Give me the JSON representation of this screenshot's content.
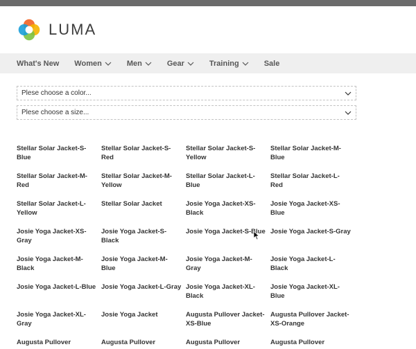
{
  "header": {
    "logo_text": "LUMA"
  },
  "nav": {
    "items": [
      {
        "label": "What's New",
        "has_menu": false
      },
      {
        "label": "Women",
        "has_menu": true
      },
      {
        "label": "Men",
        "has_menu": true
      },
      {
        "label": "Gear",
        "has_menu": true
      },
      {
        "label": "Training",
        "has_menu": true
      },
      {
        "label": "Sale",
        "has_menu": false
      }
    ]
  },
  "filters": {
    "color_placeholder": "Plese choose a color...",
    "size_placeholder": "Plese choose a size..."
  },
  "products": [
    "Stellar Solar Jacket-S-Blue",
    "Stellar Solar Jacket-S-Red",
    "Stellar Solar Jacket-S-Yellow",
    "Stellar Solar Jacket-M-Blue",
    "Stellar Solar Jacket-M-Red",
    "Stellar Solar Jacket-M-Yellow",
    "Stellar Solar Jacket-L-Blue",
    "Stellar Solar Jacket-L-Red",
    "Stellar Solar Jacket-L-Yellow",
    "Stellar Solar Jacket",
    "Josie Yoga Jacket-XS-Black",
    "Josie Yoga Jacket-XS-Blue",
    "Josie Yoga Jacket-XS-Gray",
    "Josie Yoga Jacket-S-Black",
    "Josie Yoga Jacket-S-Blue",
    "Josie Yoga Jacket-S-Gray",
    "Josie Yoga Jacket-M-Black",
    "Josie Yoga Jacket-M-Blue",
    "Josie Yoga Jacket-M-Gray",
    "Josie Yoga Jacket-L-Black",
    "Josie Yoga Jacket-L-Blue",
    "Josie Yoga Jacket-L-Gray",
    "Josie Yoga Jacket-XL-Black",
    "Josie Yoga Jacket-XL-Blue",
    "Josie Yoga Jacket-XL-Gray",
    "Josie Yoga Jacket",
    "Augusta Pullover Jacket-XS-Blue",
    "Augusta Pullover Jacket-XS-Orange",
    "Augusta Pullover",
    "Augusta Pullover",
    "Augusta Pullover",
    "Augusta Pullover"
  ],
  "colors": {
    "nav_bg": "#efefef",
    "top_strip": "#6b6b6b"
  }
}
